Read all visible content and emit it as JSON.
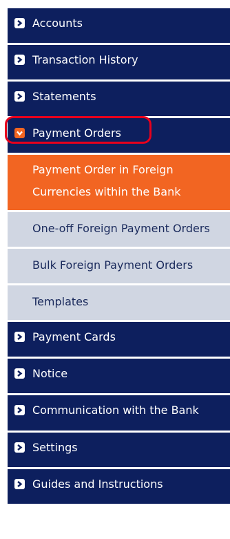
{
  "menu": {
    "accounts": "Accounts",
    "transaction_history": "Transaction History",
    "statements": "Statements",
    "payment_orders": "Payment Orders",
    "payment_orders_sub": [
      "Payment Order in Foreign Currencies within the Bank",
      "One-off Foreign Payment Orders",
      "Bulk Foreign Payment Orders",
      "Templates"
    ],
    "payment_cards": "Payment Cards",
    "notice": "Notice",
    "communication": "Communication with the Bank",
    "settings": "Settings",
    "guides": "Guides and Instructions"
  },
  "colors": {
    "nav_bg": "#0d1f5e",
    "sub_bg": "#d0d6e2",
    "selected_bg": "#f26522",
    "highlight_ring": "#e8001c"
  },
  "icons": {
    "closed": "chevron-right-icon",
    "open": "chevron-down-icon"
  }
}
